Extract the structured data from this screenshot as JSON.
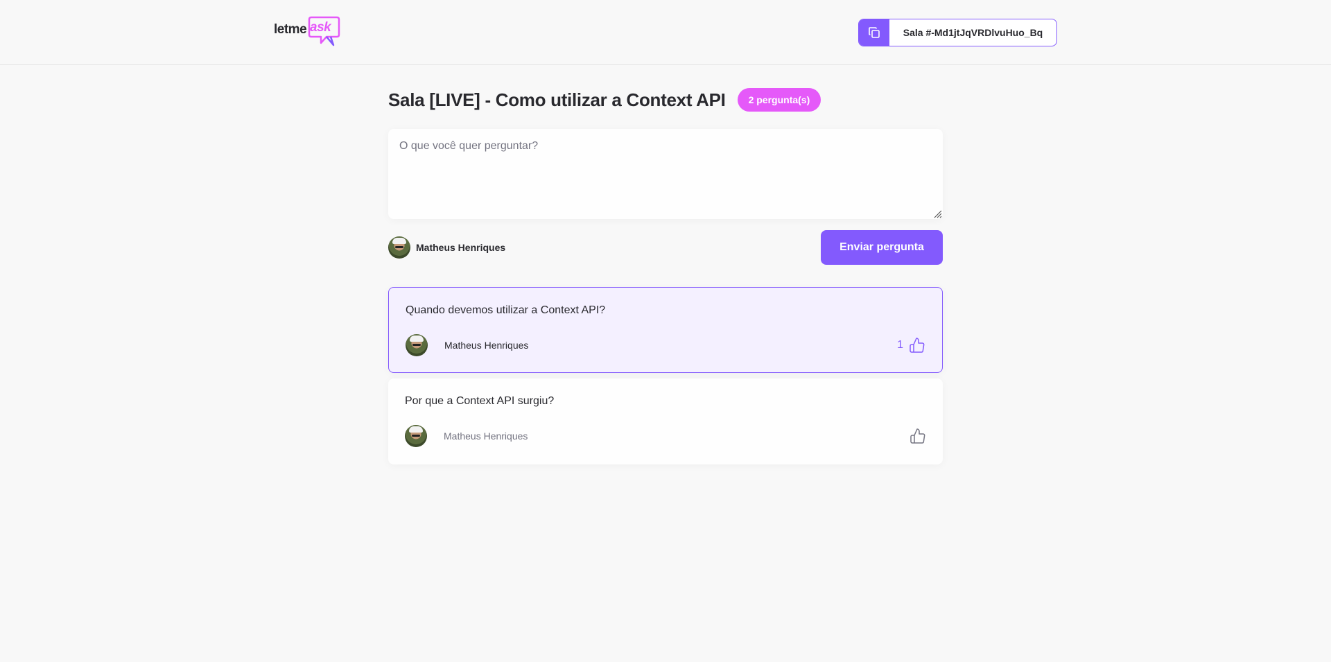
{
  "header": {
    "logo": {
      "part1": "letme",
      "part2": "ask"
    },
    "room_code": {
      "label": "Sala #-Md1jtJqVRDlvuHuo_Bq",
      "copy_icon": "copy-icon"
    }
  },
  "room": {
    "title": "Sala [LIVE] - Como utilizar a Context API",
    "question_count": "2 pergunta(s)"
  },
  "form": {
    "placeholder": "O que você quer perguntar?",
    "value": "",
    "user_name": "Matheus Henriques",
    "submit_label": "Enviar pergunta"
  },
  "questions": [
    {
      "content": "Quando devemos utilizar a Context API?",
      "author": "Matheus Henriques",
      "like_count": "1",
      "highlighted": true
    },
    {
      "content": "Por que a Context API surgiu?",
      "author": "Matheus Henriques",
      "like_count": "",
      "highlighted": false
    }
  ],
  "colors": {
    "primary": "#835afd",
    "accent": "#e559f9",
    "background": "#f8f8f8",
    "highlight_bg": "#f4f0ff",
    "text": "#29292e",
    "muted": "#737380"
  },
  "icons": {
    "like": "thumbs-up-icon",
    "copy": "copy-icon"
  }
}
